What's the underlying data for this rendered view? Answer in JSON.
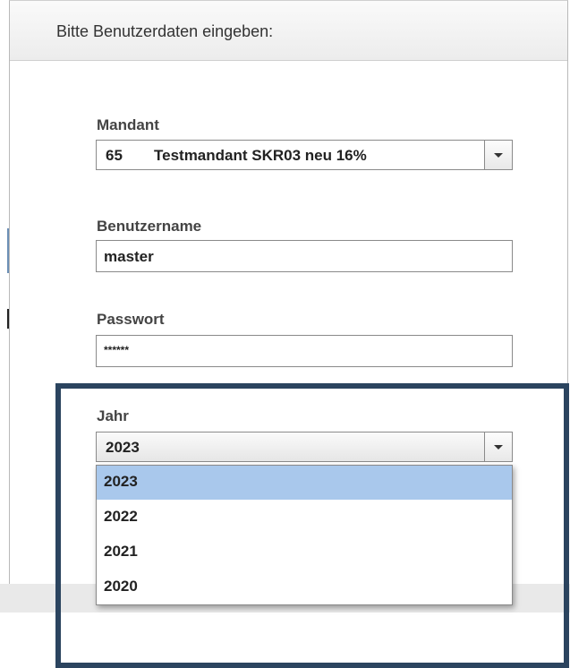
{
  "dialog": {
    "title": "Bitte Benutzerdaten eingeben:"
  },
  "form": {
    "mandant": {
      "label": "Mandant",
      "number": "65",
      "name": "Testmandant SKR03 neu 16%"
    },
    "benutzername": {
      "label": "Benutzername",
      "value": "master"
    },
    "passwort": {
      "label": "Passwort",
      "value": "******"
    },
    "jahr": {
      "label": "Jahr",
      "value": "2023",
      "options": [
        "2023",
        "2022",
        "2021",
        "2020"
      ],
      "highlighted_option": "2023"
    }
  },
  "colors": {
    "highlight_frame": "#2b445f",
    "selected_option": "#a9c8ec"
  }
}
